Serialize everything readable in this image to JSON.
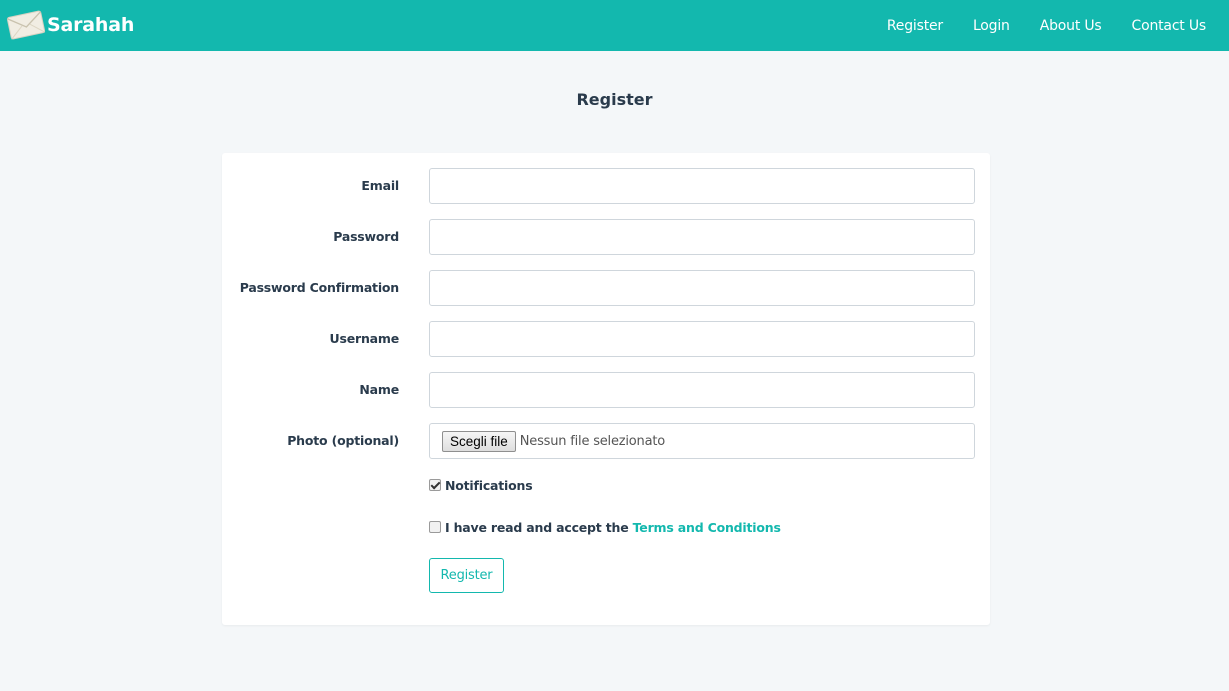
{
  "brand": {
    "name": "Sarahah",
    "logo_icon": "envelope-icon"
  },
  "nav": {
    "items": [
      {
        "label": "Register"
      },
      {
        "label": "Login"
      },
      {
        "label": "About Us"
      },
      {
        "label": "Contact Us"
      }
    ]
  },
  "page": {
    "title": "Register"
  },
  "form": {
    "email": {
      "label": "Email",
      "value": ""
    },
    "password": {
      "label": "Password",
      "value": ""
    },
    "password_confirmation": {
      "label": "Password Confirmation",
      "value": ""
    },
    "username": {
      "label": "Username",
      "value": ""
    },
    "name": {
      "label": "Name",
      "value": ""
    },
    "photo": {
      "label": "Photo (optional)",
      "button_label": "Scegli file",
      "status": "Nessun file selezionato"
    },
    "notifications": {
      "label": "Notifications",
      "checked": true
    },
    "terms": {
      "label": "I have read and accept the",
      "link_text": "Terms and Conditions",
      "checked": false
    },
    "submit_label": "Register"
  },
  "colors": {
    "accent": "#13b8ae",
    "background": "#f4f7f9",
    "text": "#2a3b4c"
  }
}
